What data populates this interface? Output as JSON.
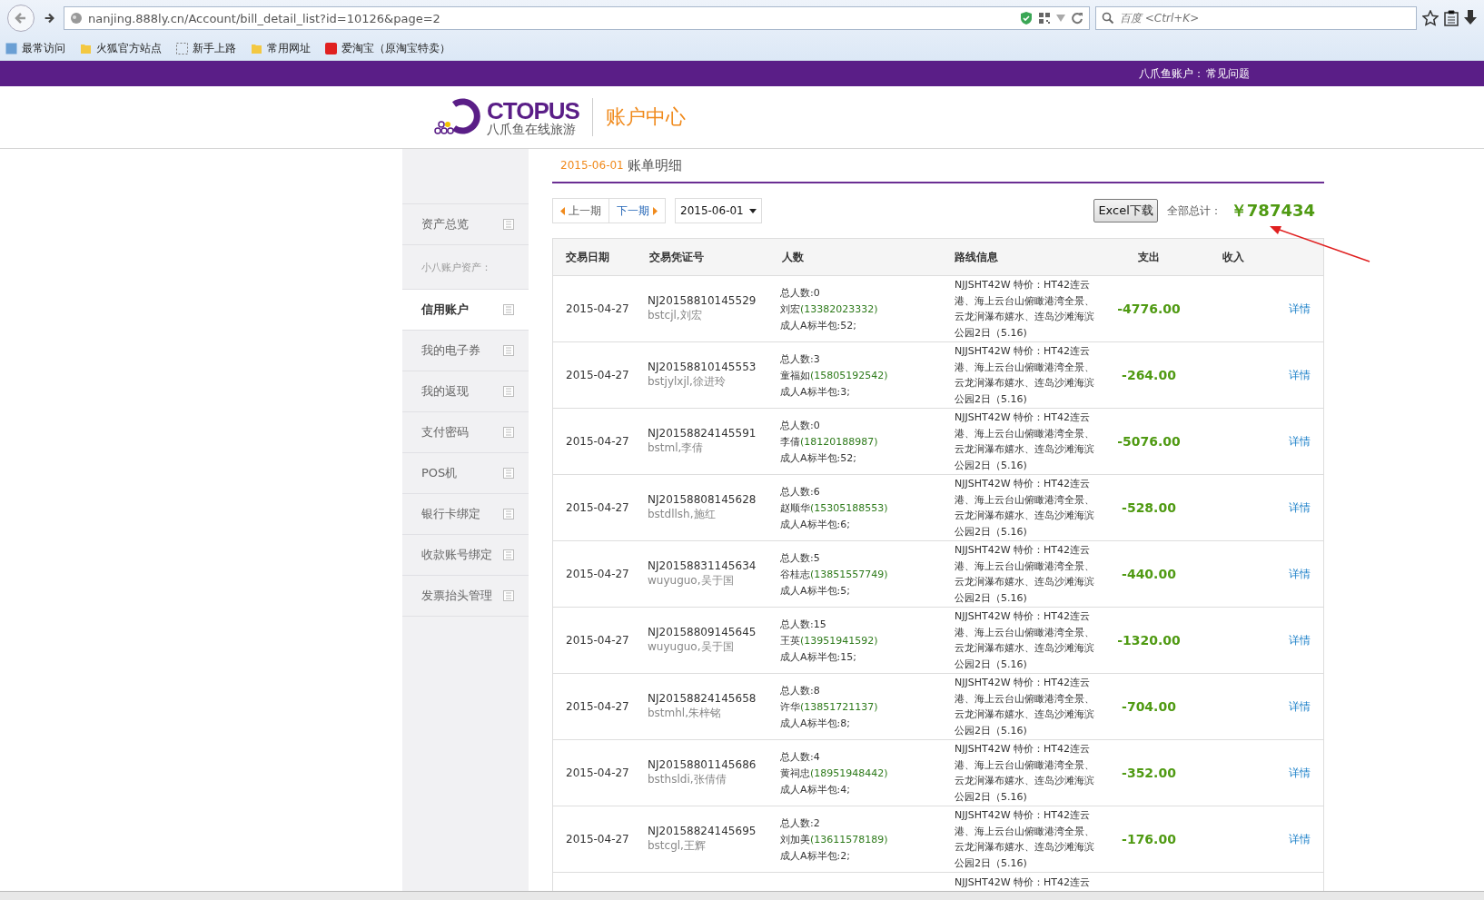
{
  "browser": {
    "url": "nanjing.888ly.cn/Account/bill_detail_list?id=10126&page=2",
    "search": {
      "placeholder": "百度 <Ctrl+K>"
    },
    "bookmarks": [
      "最常访问",
      "火狐官方站点",
      "新手上路",
      "常用网址",
      "爱淘宝（原淘宝特卖）"
    ]
  },
  "topbar": {
    "account": "八爪鱼账户：",
    "help": "常见问题"
  },
  "header": {
    "logo_word": "CTOPUS",
    "logo_sub": "八爪鱼在线旅游",
    "title": "账户中心"
  },
  "sidebar": {
    "items": [
      {
        "kind": "item",
        "label": "资产总览",
        "selected": false
      },
      {
        "kind": "section",
        "label": "小八账户资产："
      },
      {
        "kind": "item",
        "label": "信用账户",
        "selected": true
      },
      {
        "kind": "item",
        "label": "我的电子券",
        "selected": false
      },
      {
        "kind": "item",
        "label": "我的返现",
        "selected": false
      },
      {
        "kind": "item",
        "label": "支付密码",
        "selected": false
      },
      {
        "kind": "item",
        "label": "POS机",
        "selected": false
      },
      {
        "kind": "item",
        "label": "银行卡绑定",
        "selected": false
      },
      {
        "kind": "item",
        "label": "收款账号绑定",
        "selected": false
      },
      {
        "kind": "item",
        "label": "发票抬头管理",
        "selected": false
      }
    ]
  },
  "page": {
    "date": "2015-06-01",
    "title": "账单明细"
  },
  "toolbar": {
    "prev": "上一期",
    "next": "下一期",
    "period": "2015-06-01",
    "excel": "Excel下载",
    "total_label": "全部总计：",
    "total": "￥787434"
  },
  "table": {
    "columns": [
      "交易日期",
      "交易凭证号",
      "人数",
      "路线信息",
      "支出",
      "收入"
    ],
    "rows": [
      {
        "date": "2015-04-27",
        "voucher": "NJ20158810145529",
        "agent": "bstcjl,刘宏",
        "count": "总人数:0",
        "contact": "刘宏",
        "phone": "(13382023332)",
        "package": "成人A标半包:52;",
        "route": "NJJSHT42W 特价：HT42连云港、海上云台山俯瞰港湾全景、云龙涧瀑布嬉水、连岛沙滩海滨公园2日（5.16)",
        "expense": "-4776.00",
        "link": "详情"
      },
      {
        "date": "2015-04-27",
        "voucher": "NJ20158810145553",
        "agent": "bstjylxjl,徐进玲",
        "count": "总人数:3",
        "contact": "童福如",
        "phone": "(15805192542)",
        "package": "成人A标半包:3;",
        "route": "NJJSHT42W 特价：HT42连云港、海上云台山俯瞰港湾全景、云龙涧瀑布嬉水、连岛沙滩海滨公园2日（5.16)",
        "expense": "-264.00",
        "link": "详情"
      },
      {
        "date": "2015-04-27",
        "voucher": "NJ20158824145591",
        "agent": "bstml,李倩",
        "count": "总人数:0",
        "contact": "李倩",
        "phone": "(18120188987)",
        "package": "成人A标半包:52;",
        "route": "NJJSHT42W 特价：HT42连云港、海上云台山俯瞰港湾全景、云龙涧瀑布嬉水、连岛沙滩海滨公园2日（5.16)",
        "expense": "-5076.00",
        "link": "详情"
      },
      {
        "date": "2015-04-27",
        "voucher": "NJ20158808145628",
        "agent": "bstdllsh,施红",
        "count": "总人数:6",
        "contact": "赵顺华",
        "phone": "(15305188553)",
        "package": "成人A标半包:6;",
        "route": "NJJSHT42W 特价：HT42连云港、海上云台山俯瞰港湾全景、云龙涧瀑布嬉水、连岛沙滩海滨公园2日（5.16)",
        "expense": "-528.00",
        "link": "详情"
      },
      {
        "date": "2015-04-27",
        "voucher": "NJ20158831145634",
        "agent": "wuyuguo,吴于国",
        "count": "总人数:5",
        "contact": "谷桂志",
        "phone": "(13851557749)",
        "package": "成人A标半包:5;",
        "route": "NJJSHT42W 特价：HT42连云港、海上云台山俯瞰港湾全景、云龙涧瀑布嬉水、连岛沙滩海滨公园2日（5.16)",
        "expense": "-440.00",
        "link": "详情"
      },
      {
        "date": "2015-04-27",
        "voucher": "NJ20158809145645",
        "agent": "wuyuguo,吴于国",
        "count": "总人数:15",
        "contact": "王英",
        "phone": "(13951941592)",
        "package": "成人A标半包:15;",
        "route": "NJJSHT42W 特价：HT42连云港、海上云台山俯瞰港湾全景、云龙涧瀑布嬉水、连岛沙滩海滨公园2日（5.16)",
        "expense": "-1320.00",
        "link": "详情"
      },
      {
        "date": "2015-04-27",
        "voucher": "NJ20158824145658",
        "agent": "bstmhl,朱梓铭",
        "count": "总人数:8",
        "contact": "许华",
        "phone": "(13851721137)",
        "package": "成人A标半包:8;",
        "route": "NJJSHT42W 特价：HT42连云港、海上云台山俯瞰港湾全景、云龙涧瀑布嬉水、连岛沙滩海滨公园2日（5.16)",
        "expense": "-704.00",
        "link": "详情"
      },
      {
        "date": "2015-04-27",
        "voucher": "NJ20158801145686",
        "agent": "bsthsldi,张倩倩",
        "count": "总人数:4",
        "contact": "黄祠忠",
        "phone": "(18951948442)",
        "package": "成人A标半包:4;",
        "route": "NJJSHT42W 特价：HT42连云港、海上云台山俯瞰港湾全景、云龙涧瀑布嬉水、连岛沙滩海滨公园2日（5.16)",
        "expense": "-352.00",
        "link": "详情"
      },
      {
        "date": "2015-04-27",
        "voucher": "NJ20158824145695",
        "agent": "bstcgl,王辉",
        "count": "总人数:2",
        "contact": "刘加美",
        "phone": "(13611578189)",
        "package": "成人A标半包:2;",
        "route": "NJJSHT42W 特价：HT42连云港、海上云台山俯瞰港湾全景、云龙涧瀑布嬉水、连岛沙滩海滨公园2日（5.16)",
        "expense": "-176.00",
        "link": "详情"
      }
    ],
    "partial_row": {
      "route": "NJJSHT42W 特价：HT42连云"
    }
  }
}
